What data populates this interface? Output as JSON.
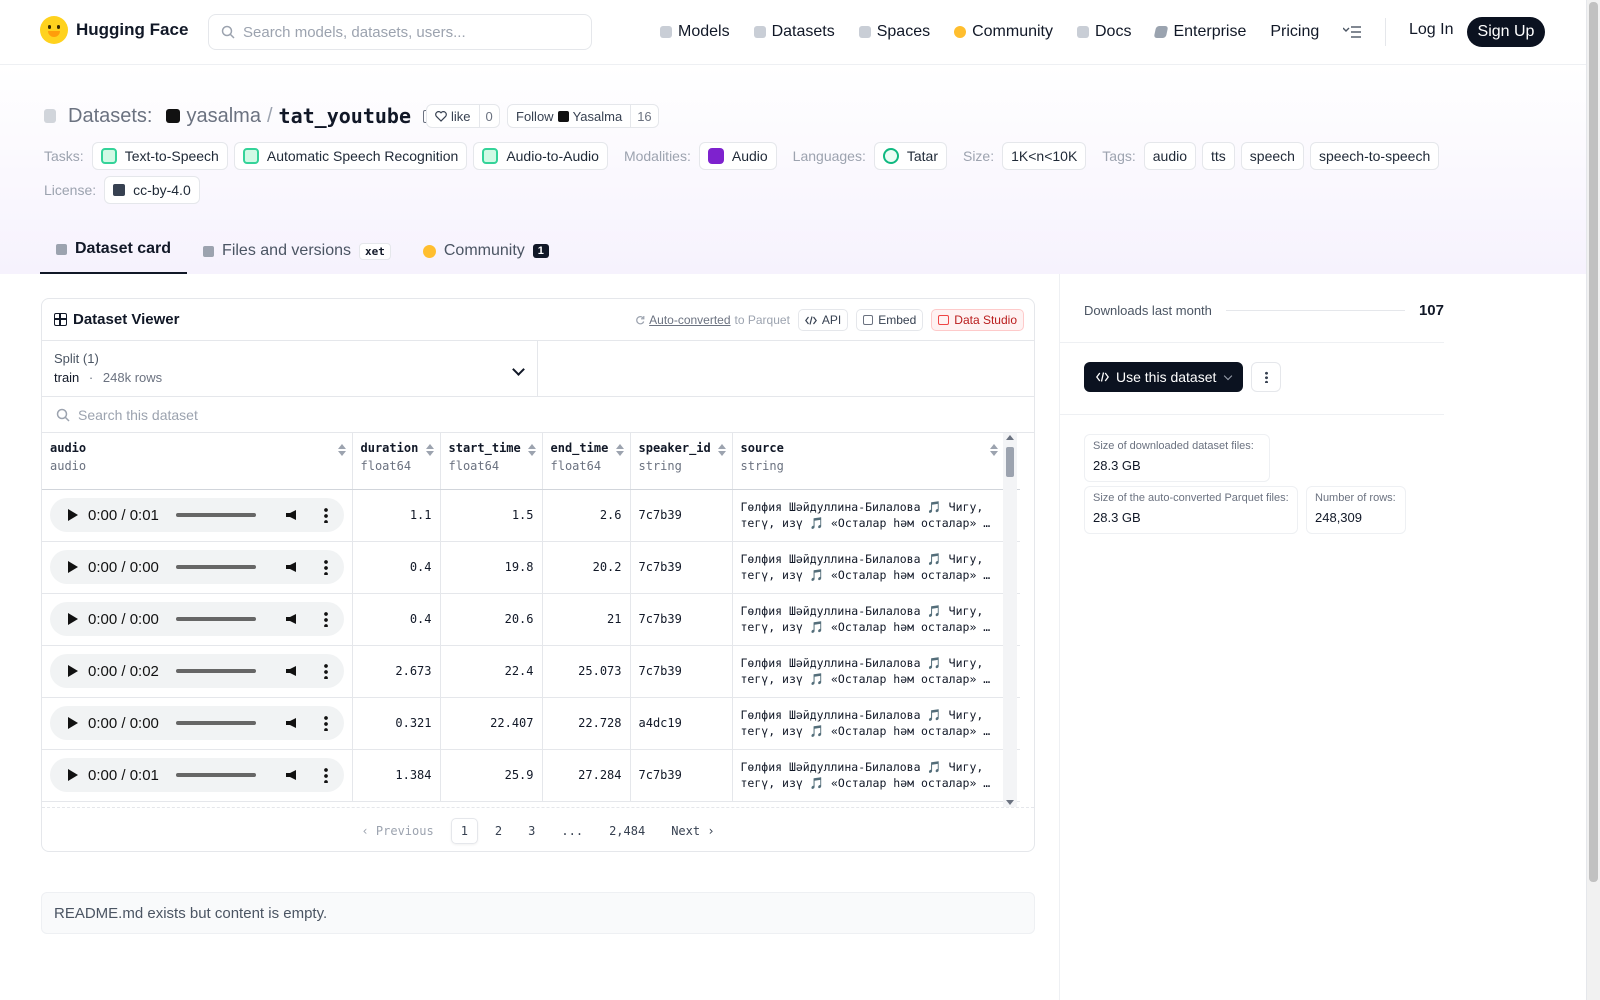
{
  "brand": {
    "name": "Hugging Face"
  },
  "search": {
    "placeholder": "Search models, datasets, users..."
  },
  "nav": {
    "items": [
      "Models",
      "Datasets",
      "Spaces",
      "Community",
      "Docs",
      "Enterprise",
      "Pricing"
    ],
    "login": "Log In",
    "signup": "Sign Up"
  },
  "dataset": {
    "section": "Datasets:",
    "owner": "yasalma",
    "separator": "/",
    "name": "tat_youtube",
    "like_label": "like",
    "like_count": "0",
    "follow_label": "Follow",
    "follow_owner": "Yasalma",
    "follow_count": "16"
  },
  "tags": {
    "tasks_label": "Tasks:",
    "tasks": [
      "Text-to-Speech",
      "Automatic Speech Recognition",
      "Audio-to-Audio"
    ],
    "modalities_label": "Modalities:",
    "modalities": [
      "Audio"
    ],
    "languages_label": "Languages:",
    "languages": [
      "Tatar"
    ],
    "size_label": "Size:",
    "size": "1K<n<10K",
    "tags_label": "Tags:",
    "tag_list": [
      "audio",
      "tts",
      "speech",
      "speech-to-speech"
    ],
    "license_label": "License:",
    "license": "cc-by-4.0"
  },
  "tabs": {
    "dataset_card": "Dataset card",
    "files": "Files and versions",
    "xet": "xet",
    "community": "Community",
    "community_count": "1"
  },
  "viewer": {
    "title": "Dataset Viewer",
    "auto_converted": "Auto-converted",
    "to_parquet": "to Parquet",
    "api": "API",
    "embed": "Embed",
    "data_studio": "Data Studio",
    "split_label": "Split (1)",
    "split_name": "train",
    "split_dot": "·",
    "split_rows": "248k rows",
    "search_placeholder": "Search this dataset",
    "columns": [
      {
        "name": "audio",
        "type": "audio"
      },
      {
        "name": "duration",
        "type": "float64"
      },
      {
        "name": "start_time",
        "type": "float64"
      },
      {
        "name": "end_time",
        "type": "float64"
      },
      {
        "name": "speaker_id",
        "type": "string"
      },
      {
        "name": "source",
        "type": "string"
      }
    ],
    "rows": [
      {
        "audio_time": "0:00 / 0:01",
        "duration": "1.1",
        "start_time": "1.5",
        "end_time": "2.6",
        "speaker_id": "7c7b39",
        "source": "Гөлфия Шәйдуллина-Билалова 🎵 Чигу, тегү, изү 🎵 «Осталар һәм осталар» …"
      },
      {
        "audio_time": "0:00 / 0:00",
        "duration": "0.4",
        "start_time": "19.8",
        "end_time": "20.2",
        "speaker_id": "7c7b39",
        "source": "Гөлфия Шәйдуллина-Билалова 🎵 Чигу, тегү, изү 🎵 «Осталар һәм осталар» …"
      },
      {
        "audio_time": "0:00 / 0:00",
        "duration": "0.4",
        "start_time": "20.6",
        "end_time": "21",
        "speaker_id": "7c7b39",
        "source": "Гөлфия Шәйдуллина-Билалова 🎵 Чигу, тегү, изү 🎵 «Осталар һәм осталар» …"
      },
      {
        "audio_time": "0:00 / 0:02",
        "duration": "2.673",
        "start_time": "22.4",
        "end_time": "25.073",
        "speaker_id": "7c7b39",
        "source": "Гөлфия Шәйдуллина-Билалова 🎵 Чигу, тегү, изү 🎵 «Осталар һәм осталар» …"
      },
      {
        "audio_time": "0:00 / 0:00",
        "duration": "0.321",
        "start_time": "22.407",
        "end_time": "22.728",
        "speaker_id": "a4dc19",
        "source": "Гөлфия Шәйдуллина-Билалова 🎵 Чигу, тегү, изү 🎵 «Осталар һәм осталар» …"
      },
      {
        "audio_time": "0:00 / 0:01",
        "duration": "1.384",
        "start_time": "25.9",
        "end_time": "27.284",
        "speaker_id": "7c7b39",
        "source": "Гөлфия Шәйдуллина-Билалова 🎵 Чигу, тегү, изү 🎵 «Осталар һәм осталар» …"
      }
    ],
    "pager": {
      "previous": "Previous",
      "pages": [
        "1",
        "2",
        "3",
        "...",
        "2,484"
      ],
      "next": "Next"
    }
  },
  "readme": {
    "text": "README.md exists but content is empty."
  },
  "sidebar": {
    "downloads_label": "Downloads last month",
    "downloads": "107",
    "use_dataset": "Use this dataset",
    "stats": {
      "downloaded_label": "Size of downloaded dataset files:",
      "downloaded_value": "28.3 GB",
      "parquet_label": "Size of the auto-converted Parquet files:",
      "parquet_value": "28.3 GB",
      "rows_label": "Number of rows:",
      "rows_value": "248,309"
    }
  },
  "icons": {
    "search": "search-icon",
    "copy": "copy-icon",
    "heart": "heart-icon",
    "menu": "menu-icon",
    "play": "play-icon",
    "volume": "volume-icon",
    "more": "more-vertical-icon",
    "code": "code-icon"
  },
  "colors": {
    "accent": "#0b1220",
    "brand_yellow": "#ffd21e",
    "data_studio_red": "#ef4444"
  }
}
